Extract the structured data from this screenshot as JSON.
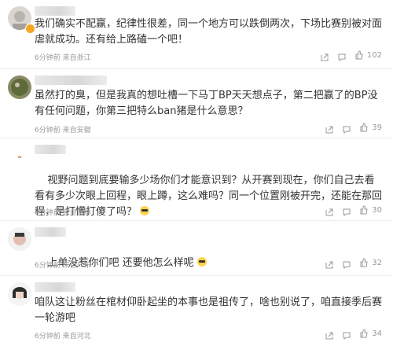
{
  "comments": [
    {
      "text": "我们确实不配赢，纪律性很差，同一个地方可以跌倒两次，下场比赛别被对面虐就成功。还有给上路磕一个吧！",
      "meta": "6分钟前 来自浙江",
      "likes": "102"
    },
    {
      "text": "虽然打的臭，但是我真的想吐槽一下马丁BP天天想点子，第二把赢了的BP没有任何问题，你第三把特么ban猪是什么意思？",
      "meta": "6分钟前 来自安徽",
      "likes": "39"
    },
    {
      "text": "视野问题到底要输多少场你们才能意识到？从开赛到现在，你们自己去看看有多少次眼上回程，眼上蹲，这么难吗？同一个位置刚被开完，还能在那回程，是打懵打傻了吗？",
      "meta": "6分钟前 来自吉林",
      "likes": "30"
    },
    {
      "text": "上单没惹你们吧 还要他怎么样呢",
      "meta": "6分钟前 来自广东",
      "likes": "32"
    },
    {
      "text": "咱队这让粉丝在棺材仰卧起坐的本事也是祖传了，啥也别说了，咱直接季后赛一轮游吧",
      "meta": "6分钟前 来自河北",
      "likes": "34"
    }
  ],
  "icons": [
    "share-icon",
    "comment-icon",
    "like-icon"
  ],
  "colors": {
    "text": "#333333",
    "meta": "#999999",
    "badge": "#f5a623"
  }
}
